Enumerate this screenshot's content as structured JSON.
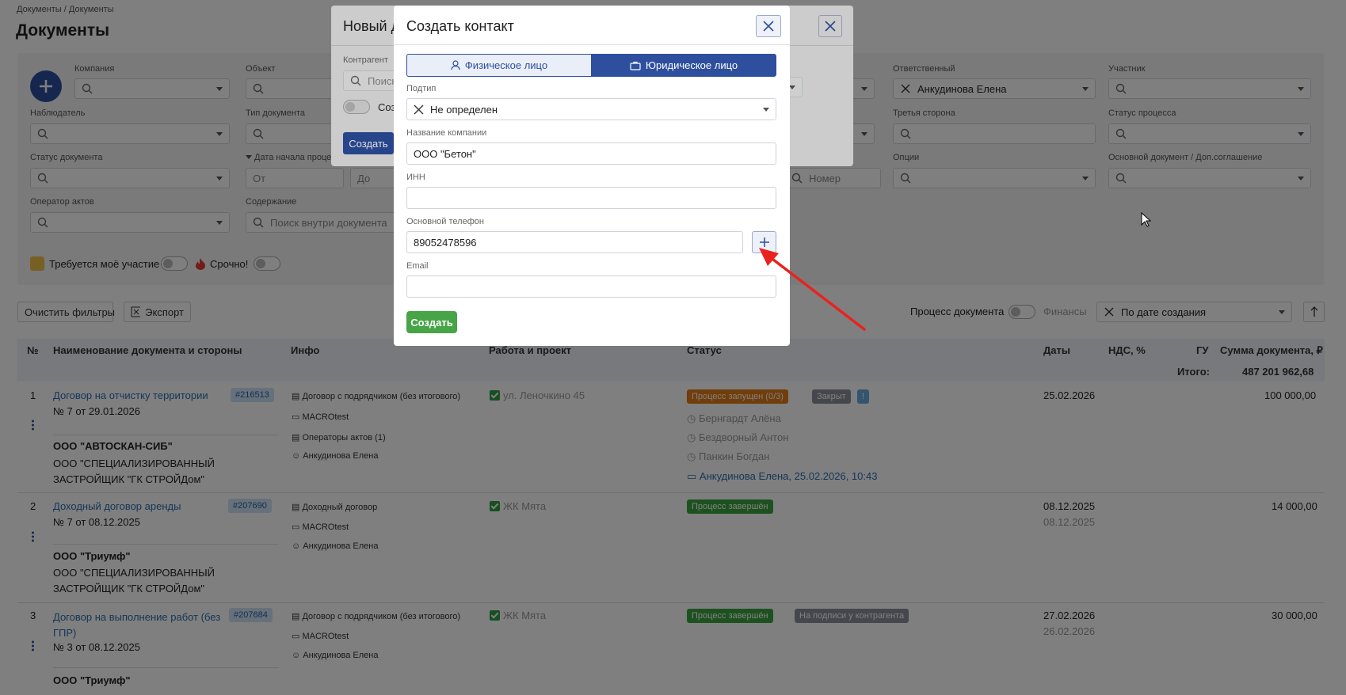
{
  "breadcrumb": {
    "root": "Документы",
    "sep": "/",
    "current": "Документы"
  },
  "page_title": "Документы",
  "filters": {
    "company": "Компания",
    "object": "Объект",
    "responsible": "Ответственный",
    "responsible_value": "Анкудинова Елена",
    "participant": "Участник",
    "observer": "Наблюдатель",
    "doc_type": "Тип документа",
    "third_party": "Третья сторона",
    "process_status": "Статус процесса",
    "doc_status": "Статус документа",
    "process_start_date": "Дата начала проце",
    "date_from": "От",
    "date_to": "До",
    "number": "Номер",
    "options": "Опции",
    "main_doc": "Основной документ / Доп.соглашение",
    "act_operator": "Оператор актов",
    "content": "Содержание",
    "content_placeholder": "Поиск внутри документа",
    "my_participation": "Требуется моё участие",
    "urgent": "Срочно!"
  },
  "toolbar": {
    "clear_filters": "Очистить фильтры",
    "export": "Экспорт",
    "doc_process": "Процесс документа",
    "finance": "Финансы",
    "sort_value": "По дате создания"
  },
  "table": {
    "headers": {
      "num": "№",
      "name": "Наименование документа и стороны",
      "info": "Инфо",
      "work": "Работа и проект",
      "status": "Статус",
      "dates": "Даты",
      "vat": "НДС, %",
      "gu": "ГУ",
      "sum": "Сумма документа, ₽"
    },
    "total_label": "Итого:",
    "total_value": "487 201 962,68",
    "rows": [
      {
        "num": "1",
        "title": "Договор на отчистку территории",
        "number_line": "№ 7  от 29.01.2026",
        "id": "#216513",
        "party1": "ООО \"АВТОСКАН-СИБ\"",
        "party2": "ООО \"СПЕЦИАЛИЗИРОВАННЫЙ ЗАСТРОЙЩИК \"ГК СТРОЙДом\"",
        "info_type": "Договор с подрядчиком (без итогового)",
        "info_company": "MACROtest",
        "info_operators": "Операторы актов (1)",
        "info_person": "Анкудинова Елена",
        "work": "ул. Леночкино 45",
        "status_tag": "Процесс запущен (0/3)",
        "status_tag2": "Закрыт",
        "status_tag3": "!",
        "approvers": [
          "Бернгардт Алёна",
          "Бездворный Антон",
          "Панкин Богдан"
        ],
        "comment": "Анкудинова Елена, 25.02.2026, 10:43",
        "date1": "25.02.2026",
        "sum": "100 000,00"
      },
      {
        "num": "2",
        "title": "Доходный договор аренды",
        "number_line": "№ 7  от 08.12.2025",
        "id": "#207690",
        "party1": "ООО \"Триумф\"",
        "party2": "ООО \"СПЕЦИАЛИЗИРОВАННЫЙ ЗАСТРОЙЩИК \"ГК СТРОЙДом\"",
        "info_type": "Доходный договор",
        "info_company": "MACROtest",
        "info_person": "Анкудинова Елена",
        "work": "ЖК Мята",
        "status_tag": "Процесс завершён",
        "date1": "08.12.2025",
        "date2": "08.12.2025",
        "sum": "14 000,00"
      },
      {
        "num": "3",
        "title": "Договор на выполнение работ (без ГПР)",
        "number_line": "№ 3  от 08.12.2025",
        "id": "#207684",
        "party1": "ООО \"Триумф\"",
        "info_type": "Договор с подрядчиком (без итогового)",
        "info_company": "MACROtest",
        "info_person": "Анкудинова Елена",
        "work": "ЖК Мята",
        "status_tag": "Процесс завершён",
        "status_tag2": "На подписи у контрагента",
        "date1": "27.02.2026",
        "date2": "26.02.2026",
        "sum": "30 000,00"
      }
    ]
  },
  "back_modal": {
    "title": "Новый д",
    "counterparty_label": "Контрагент",
    "search_placeholder": "Поиск",
    "toggle_label": "Соз",
    "create_label": "Создать"
  },
  "modal": {
    "title": "Создать контакт",
    "tab_person": "Физическое лицо",
    "tab_legal": "Юридическое лицо",
    "subtype_label": "Подтип",
    "subtype_value": "Не определен",
    "company_label": "Название компании",
    "company_value": "ООО \"Бетон\"",
    "inn_label": "ИНН",
    "inn_value": "",
    "phone_label": "Основной телефон",
    "phone_value": "89052478596",
    "email_label": "Email",
    "email_value": "",
    "create_label": "Создать"
  },
  "colors": {
    "primary": "#2d4f9e",
    "success": "#47a447",
    "annotation_arrow": "#e8231f",
    "tag_orange": "#e07b16",
    "tag_green": "#3aa441",
    "tag_grey": "#8a8f98",
    "tag_blue": "#6aa9e0",
    "id_badge": "#cfe2f7"
  }
}
